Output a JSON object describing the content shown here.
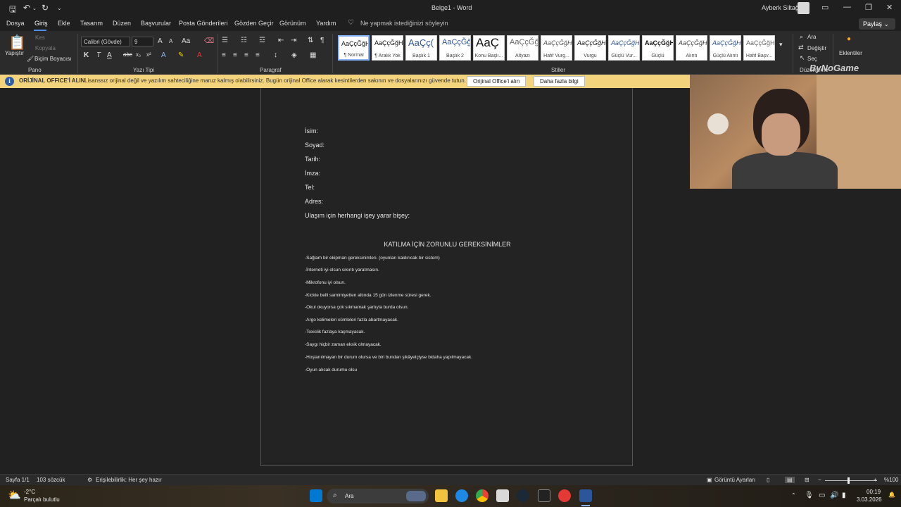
{
  "titlebar": {
    "doc_title": "Belge1  -  Word",
    "user_name": "Ayberk Siltağ",
    "icons": [
      "save-icon",
      "undo-icon",
      "redo-icon",
      "customize-icon",
      "minimize-icon",
      "maximize-icon",
      "close-icon"
    ]
  },
  "tabs": {
    "items": [
      "Dosya",
      "Giriş",
      "Ekle",
      "Tasarım",
      "Düzen",
      "Başvurular",
      "Posta Gönderileri",
      "Gözden Geçir",
      "Görünüm",
      "Yardım"
    ],
    "active": "Giriş",
    "tell_me": "Ne yapmak istediğinizi söyleyin",
    "share": "Paylaş"
  },
  "ribbon": {
    "clipboard": {
      "paste": "Yapıştır",
      "cut": "Kes",
      "copy": "Kopyala",
      "format_painter": "Biçim Boyacısı",
      "label": "Pano"
    },
    "font": {
      "name": "Calibri (Gövde)",
      "size": "9",
      "label": "Yazı Tipi",
      "bold": "K",
      "italic": "T",
      "underline": "A"
    },
    "paragraph": {
      "label": "Paragraf"
    },
    "styles": {
      "label": "Stiller",
      "items": [
        {
          "preview": "AaÇçĞğHı",
          "name": "¶ Normal"
        },
        {
          "preview": "AaÇçĞğHı",
          "name": "¶ Aralık Yok"
        },
        {
          "preview": "AaÇç(",
          "name": "Başlık 1"
        },
        {
          "preview": "AaÇçĞğ",
          "name": "Başlık 2"
        },
        {
          "preview": "AaÇ",
          "name": "Konu Başlı..."
        },
        {
          "preview": "AaÇçĞğ",
          "name": "Altyazı"
        },
        {
          "preview": "AaÇçĞğHı",
          "name": "Hafif Vurg..."
        },
        {
          "preview": "AaÇçĞğHı",
          "name": "Vurgu"
        },
        {
          "preview": "AaÇçĞğHı",
          "name": "Güçlü Vur..."
        },
        {
          "preview": "AaÇçĞğHı",
          "name": "Güçlü"
        },
        {
          "preview": "AaÇçĞğHı",
          "name": "Alıntı"
        },
        {
          "preview": "AaÇçĞğHı",
          "name": "Güçlü Alıntı"
        },
        {
          "preview": "AaÇçĞğHı",
          "name": "Hafif Başv..."
        }
      ]
    },
    "editing": {
      "find": "Ara",
      "replace": "Değiştir",
      "select": "Seç",
      "label": "Düzenleme"
    },
    "addins": {
      "label": "Eklentiler"
    }
  },
  "infobar": {
    "title": "ORİJİNAL OFFICE'İ ALIN",
    "message": "Lisanssız orijinal değil ve yazılım sahteciliğine maruz kalmış olabilirsiniz. Bugün orijinal Office alarak kesintilerden sakının ve dosyalarınızı güvende tutun.",
    "button_get": "Orijinal Office'i alın",
    "button_more": "Daha fazla bilgi"
  },
  "document": {
    "fields": [
      "İsim:",
      "Soyad:",
      "Tarih:",
      "İmza:",
      "Tel:",
      "Adres:",
      "Ulaşım için herhangi işey yarar bişey:"
    ],
    "heading": "KATILMA İÇİN ZORUNLU GEREKSİNİMLER",
    "requirements": [
      "-Sağlam bir ekipman gereksinimleri. (oyunları kaldırıcak bir sistem)",
      "-İnterneti iyi olsun sıkıntı yaratmasın.",
      "-Mikrofonu iyi olsun.",
      "-Kickte belli samimiyetten altında 15 gün izlenme süresi gerek.",
      "-Okul okuyorsa çok sıkmamak şartıyla burda olsun.",
      "-Argo kelimeleri cümleleri fazla abartmayacak.",
      "-Toxiclik fazlaya kaçmayacak.",
      "-Saygı hiçbir zaman eksik olmayacak.",
      "-Hoşlanılmayan bir durum olursa ve biri bundan şikâyetçiyse bidaha yapılmayacak.",
      "-Oyun alıcak durumu olsu"
    ]
  },
  "overlay": {
    "watermark": "ByNoGame"
  },
  "statusbar": {
    "page": "Sayfa 1/1",
    "words": "103 sözcük",
    "accessibility": "Erişilebilirlik: Her şey hazır",
    "display_settings": "Görüntü Ayarları",
    "zoom": "%100",
    "zoom_level": 1.0
  },
  "taskbar": {
    "weather_temp": "-2°C",
    "weather_desc": "Parçalı bulutlu",
    "search": "Ara",
    "time": "00:19",
    "date": "3.03.2026"
  }
}
